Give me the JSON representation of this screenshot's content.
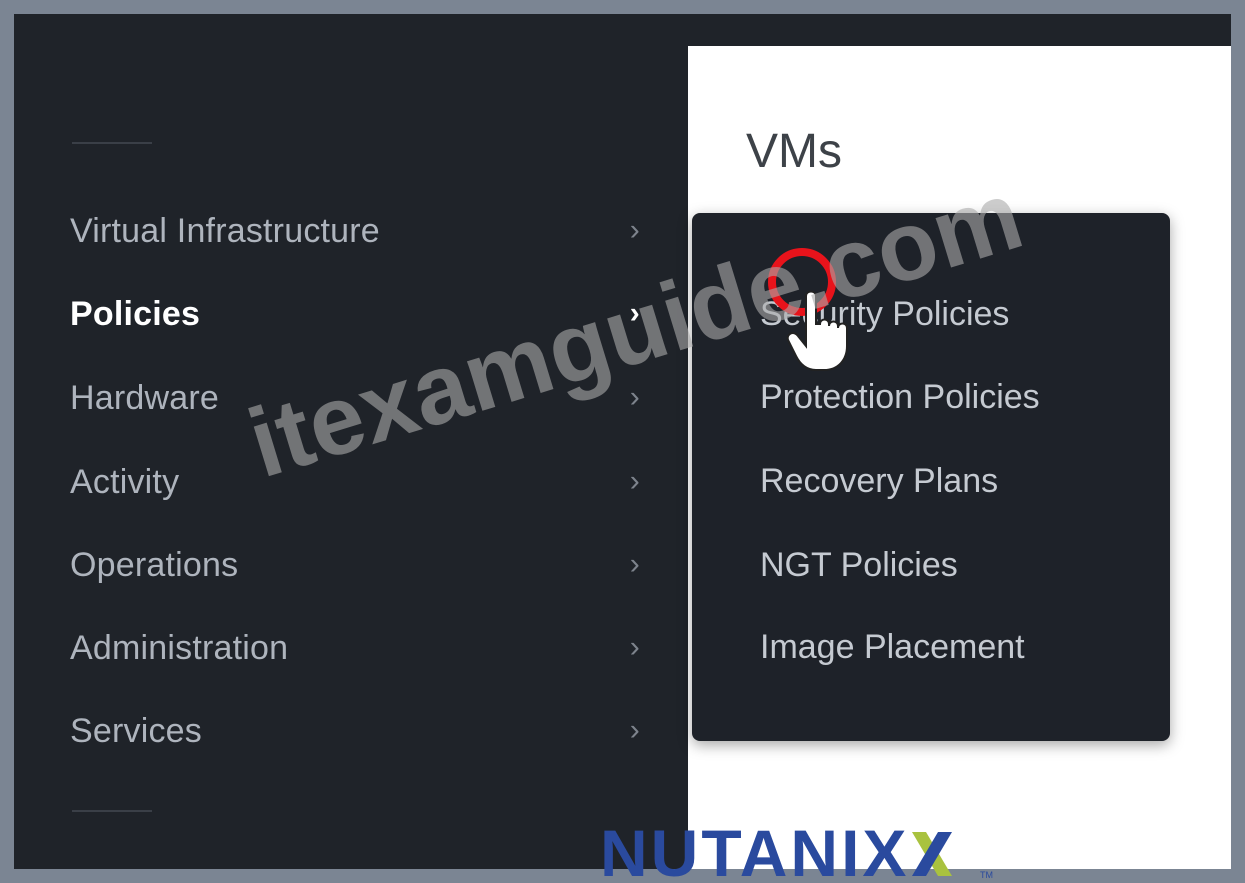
{
  "sidebar": {
    "items": [
      {
        "label": "Virtual Infrastructure",
        "chevron": "›"
      },
      {
        "label": "Policies",
        "chevron": "›",
        "active": true
      },
      {
        "label": "Hardware",
        "chevron": "›"
      },
      {
        "label": "Activity",
        "chevron": "›"
      },
      {
        "label": "Operations",
        "chevron": "›"
      },
      {
        "label": "Administration",
        "chevron": "›"
      },
      {
        "label": "Services",
        "chevron": "›"
      }
    ]
  },
  "main": {
    "title": "VMs"
  },
  "submenu": {
    "items": [
      {
        "label": "Security Policies"
      },
      {
        "label": "Protection Policies"
      },
      {
        "label": "Recovery Plans"
      },
      {
        "label": "NGT Policies"
      },
      {
        "label": "Image Placement"
      }
    ]
  },
  "watermark": {
    "text": "itexamguide.com"
  },
  "logo": {
    "text": "NUTANIX",
    "tm": "TM"
  },
  "colors": {
    "sidebar_bg": "#1f2329",
    "menu_bg": "#1e2229",
    "highlight_ring": "#e8131b",
    "logo_blue": "#2a4a9e",
    "logo_green": "#a9c23f"
  }
}
